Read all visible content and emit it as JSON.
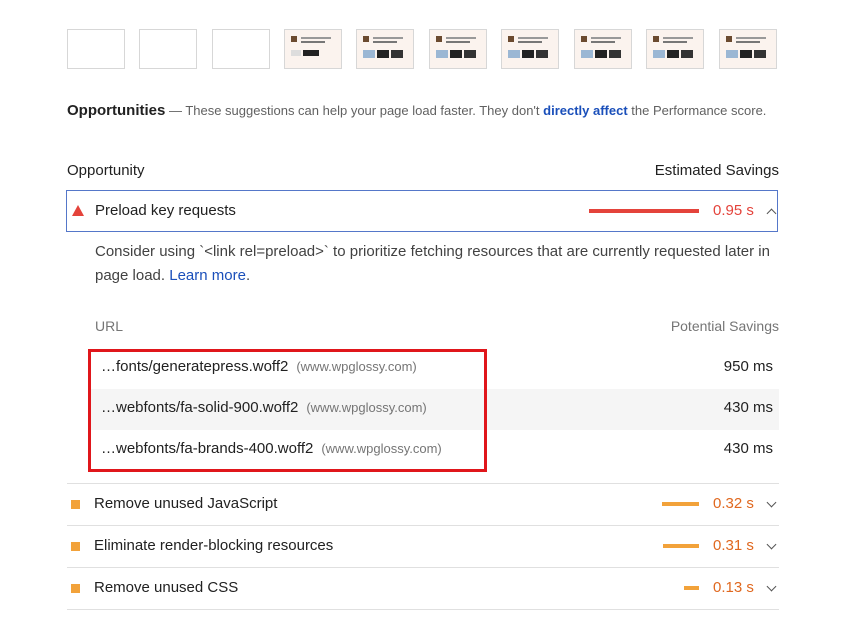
{
  "filmstrip": {
    "frames": [
      {
        "state": "blank"
      },
      {
        "state": "blank"
      },
      {
        "state": "blank"
      },
      {
        "state": "content"
      },
      {
        "state": "content"
      },
      {
        "state": "content"
      },
      {
        "state": "content"
      },
      {
        "state": "content"
      },
      {
        "state": "content"
      },
      {
        "state": "content"
      }
    ]
  },
  "opportunities": {
    "title": "Opportunities",
    "desc_prefix": " — These suggestions can help your page load faster. They don't ",
    "desc_link": "directly affect",
    "desc_suffix": " the Performance score.",
    "col_opportunity": "Opportunity",
    "col_savings": "Estimated Savings"
  },
  "open_audit": {
    "title": "Preload key requests",
    "saving": "0.95 s",
    "saving_fraction": 1.0,
    "status_color": "#e4433b",
    "description": "Consider using `<link rel=preload>` to prioritize fetching resources that are currently requested later in page load. ",
    "learn_more": "Learn more",
    "learn_more_suffix": ".",
    "table": {
      "col_url": "URL",
      "col_savings": "Potential Savings",
      "rows": [
        {
          "url": "…fonts/generatepress.woff2",
          "host": "(www.wpglossy.com)",
          "savings": "950 ms"
        },
        {
          "url": "…webfonts/fa-solid-900.woff2",
          "host": "(www.wpglossy.com)",
          "savings": "430 ms"
        },
        {
          "url": "…webfonts/fa-brands-400.woff2",
          "host": "(www.wpglossy.com)",
          "savings": "430 ms"
        }
      ]
    }
  },
  "audits": [
    {
      "title": "Remove unused JavaScript",
      "saving": "0.32 s",
      "saving_fraction": 0.34
    },
    {
      "title": "Eliminate render-blocking resources",
      "saving": "0.31 s",
      "saving_fraction": 0.33
    },
    {
      "title": "Remove unused CSS",
      "saving": "0.13 s",
      "saving_fraction": 0.14
    }
  ],
  "colors": {
    "fail": "#e4433b",
    "average": "#f2a23a",
    "link": "#1a4fba",
    "highlight_box": "#e0161b"
  }
}
